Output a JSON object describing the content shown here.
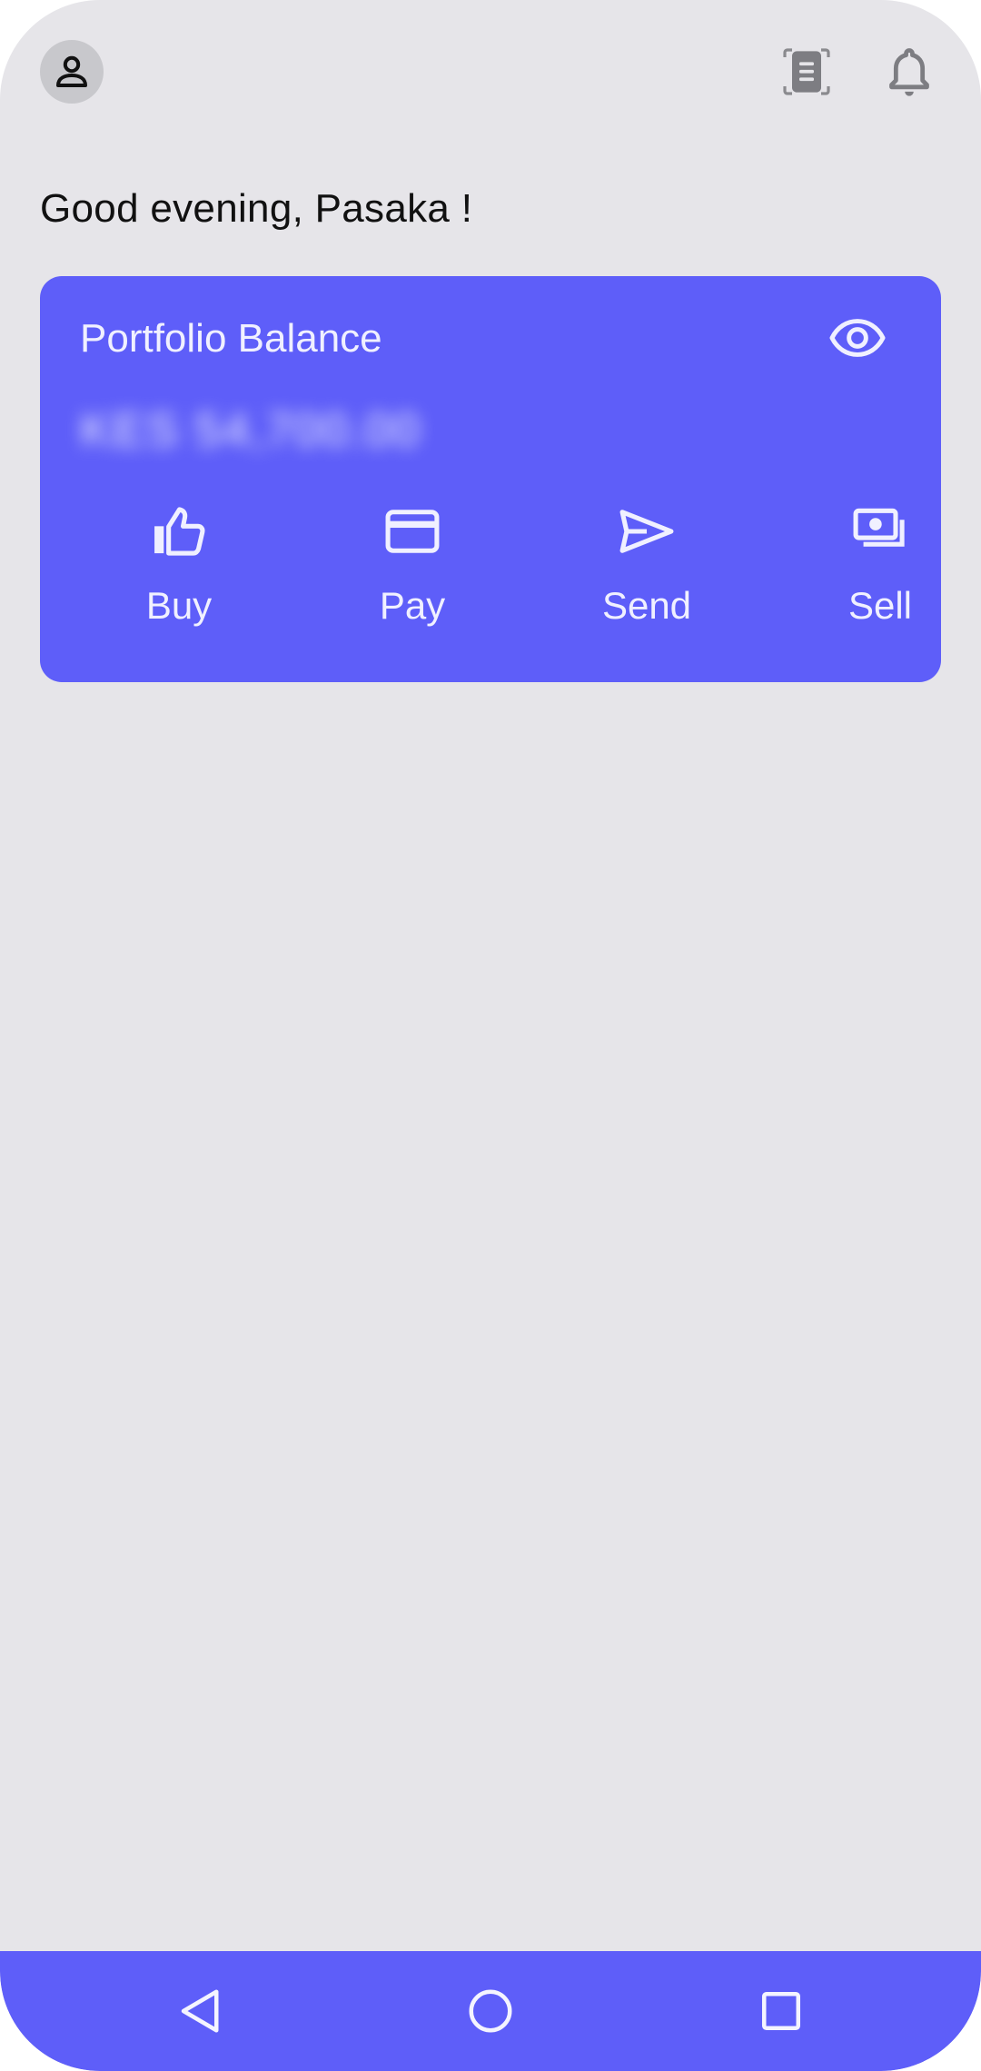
{
  "header": {
    "avatar_icon": "person-icon",
    "scan_icon": "receipt-scan-icon",
    "bell_icon": "bell-icon"
  },
  "greeting": "Good evening, Pasaka !",
  "card": {
    "title": "Portfolio Balance",
    "visibility_icon": "eye-icon",
    "balance": "KES 54,700.00",
    "actions": [
      {
        "label": "Buy",
        "icon": "thumbs-up-icon"
      },
      {
        "label": "Pay",
        "icon": "credit-card-icon"
      },
      {
        "label": "Send",
        "icon": "send-icon"
      },
      {
        "label": "Sell",
        "icon": "money-icon"
      }
    ]
  },
  "navbar": {
    "back_icon": "back-triangle-icon",
    "home_icon": "home-circle-icon",
    "recent_icon": "recents-square-icon"
  },
  "colors": {
    "accent": "#5e5ef9",
    "background": "#e6e5e9",
    "card_text": "#f0f0ff"
  }
}
